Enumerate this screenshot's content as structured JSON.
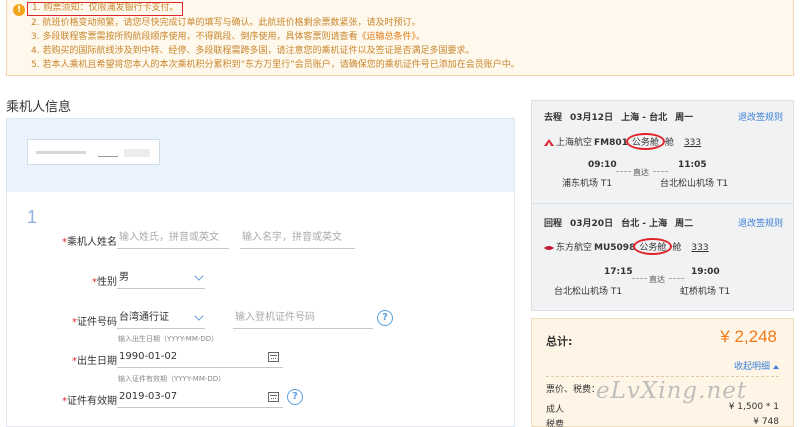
{
  "notice": {
    "icon": "warning-icon",
    "lines": [
      "1. 购票须知：仅限浦发银行卡支付。",
      "2. 航班价格变动频繁，请您尽快完成订单的填写与确认。此航班价格剩余票数紧张，请及时预订。",
      "3. 多段联程客票需按所购航段顺序使用，不得跳段、倒序使用，具体客票则请查看",
      "4. 若购买的国际航线涉及到中转、经停、多段联程需跨多国，请注意您的乘机证件以及签证是否满足多国要求。",
      "5. 若本人乘机且希望将您本人的本次乘机积分累积到“东方万里行”会员账户，请确保您的乘机证件号已添加在会员账户中。"
    ],
    "line3_link": "《运输总条件》",
    "line3_end": "。"
  },
  "section_title": "乘机人信息",
  "passenger": {
    "number": "1",
    "name_label": "乘机人姓名",
    "surname_placeholder": "输入姓氏，拼音或英文",
    "given_placeholder": "输入名字，拼音或英文",
    "gender_label": "性别",
    "gender_value": "男",
    "id_label": "证件号码",
    "id_type": "台湾通行证",
    "id_placeholder": "输入登机证件号码",
    "birth_hint": "输入出生日期（YYYY-MM-DD）",
    "birth_label": "出生日期",
    "birth_value": "1990-01-02",
    "expiry_hint": "输入证件有效期（YYYY-MM-DD）",
    "expiry_label": "证件有效期",
    "expiry_value": "2019-03-07",
    "required_mark": "*"
  },
  "segments": [
    {
      "direction": "去程",
      "date": "03月12日",
      "route": "上海 - 台北",
      "weekday": "周一",
      "change_rule": "退改签规则",
      "airline": "上海航空",
      "flight": "FM801",
      "cabin": "公务舱",
      "plane": "333",
      "dep_time": "09:10",
      "arr_time": "11:05",
      "direct": "直达",
      "dep_airport": "浦东机场 T1",
      "arr_airport": "台北松山机场 T1"
    },
    {
      "direction": "回程",
      "date": "03月20日",
      "route": "台北 - 上海",
      "weekday": "周二",
      "change_rule": "退改签规则",
      "airline": "东方航空",
      "flight": "MU5098",
      "cabin": "公务舱",
      "plane": "333",
      "dep_time": "17:15",
      "arr_time": "19:00",
      "direct": "直达",
      "dep_airport": "台北松山机场 T1",
      "arr_airport": "虹桥机场 T1"
    }
  ],
  "total": {
    "label": "总计:",
    "amount": "¥ 2,248",
    "collapse": "收起明细",
    "breakdown_head": "票价、税费：",
    "adult_label": "成人",
    "adult_value": "¥ 1,500 * 1",
    "tax_label": "税费",
    "tax_value": "¥ 748"
  },
  "watermark": "eLvXing.net",
  "colors": {
    "accent_orange": "#f07b1c",
    "link_blue": "#3a7fd5",
    "highlight_red": "#e0262d"
  }
}
